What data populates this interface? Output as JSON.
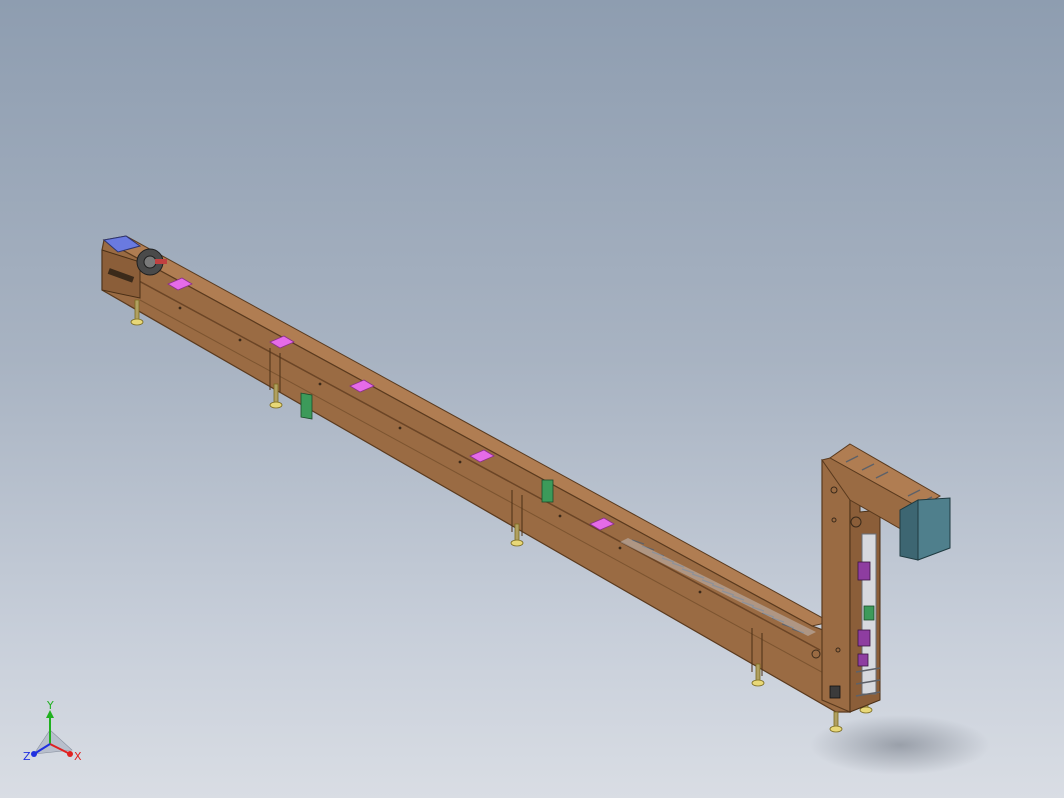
{
  "scene": {
    "background_top": "#8e9db0",
    "background_bottom": "#d9dde4",
    "frame_color": "#9a6b43",
    "frame_edge": "#5a3a1e",
    "pad_color": "#e56be8",
    "green_part_color": "#3c9a5a",
    "purple_part_color": "#8e3da0",
    "motor_color": "#4f7f8c",
    "foot_color": "#e8d878",
    "end_cap_color": "#6a7ae0",
    "roller_color": "#c9ccd2"
  },
  "triad": {
    "x_label": "X",
    "y_label": "Y",
    "z_label": "Z",
    "x_color": "#e02020",
    "y_color": "#20b020",
    "z_color": "#2030e0"
  }
}
